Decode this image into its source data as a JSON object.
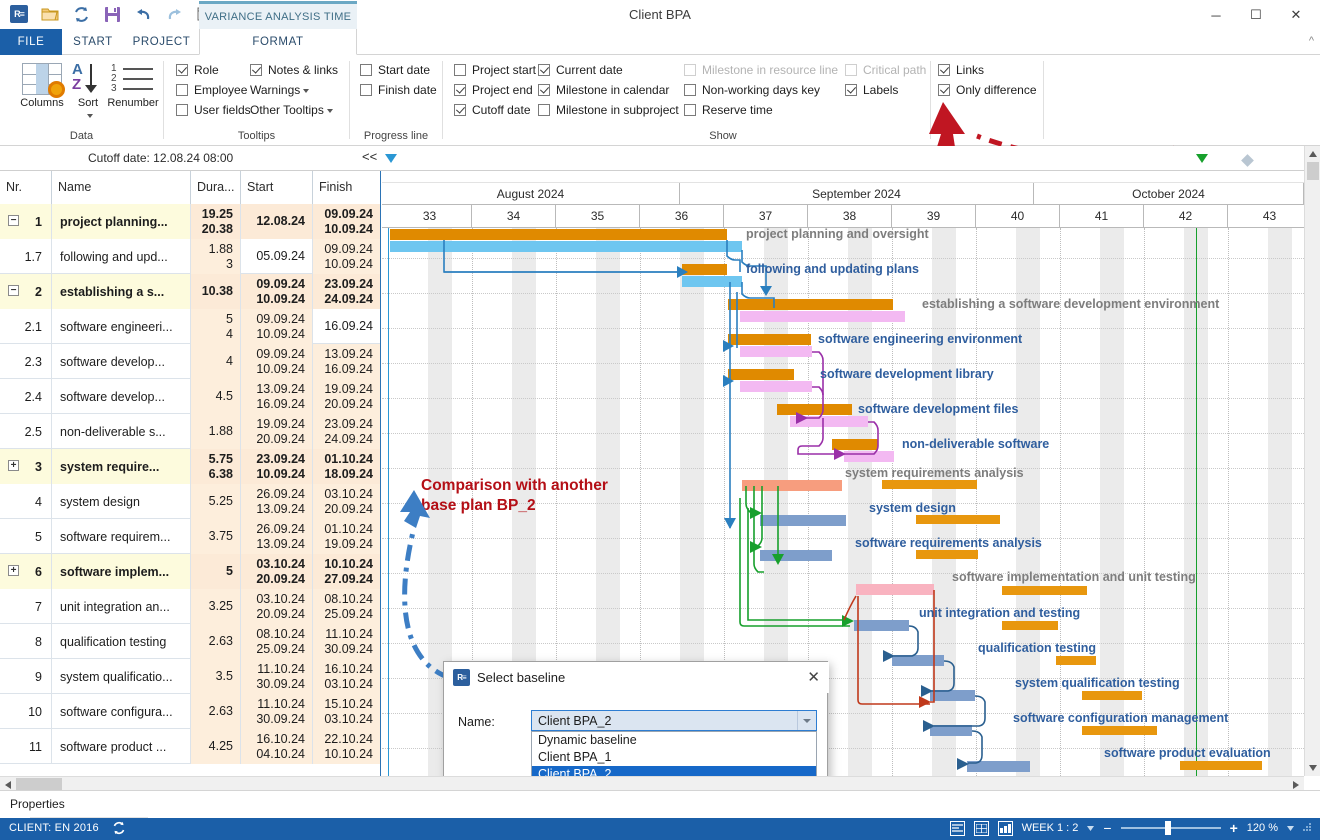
{
  "window": {
    "title": "Client BPA",
    "minimize": "─",
    "maximize": "☐",
    "close": "✕"
  },
  "quick_access": [
    {
      "name": "app-logo-icon",
      "glyph": "R≡"
    },
    {
      "name": "open-icon",
      "glyph": "🗁"
    },
    {
      "name": "refresh-icon",
      "glyph": "↻"
    },
    {
      "name": "save-icon",
      "glyph": "💾"
    },
    {
      "name": "undo-icon",
      "glyph": "↶"
    },
    {
      "name": "redo-icon",
      "glyph": "↷"
    },
    {
      "name": "window-icon",
      "glyph": "▭"
    },
    {
      "name": "customize-qat-icon",
      "glyph": "▾"
    }
  ],
  "ribbon": {
    "contextual_tab": "VARIANCE ANALYSIS TIME",
    "tabs": [
      {
        "label": "FILE",
        "active": false
      },
      {
        "label": "START",
        "active": false
      },
      {
        "label": "PROJECT",
        "active": false
      },
      {
        "label": "FORMAT",
        "active": true
      }
    ],
    "groups": [
      {
        "label": "Data",
        "buttons": [
          {
            "label": "Columns",
            "icon": "columns-icon"
          },
          {
            "label": "Sort",
            "icon": "sort-icon",
            "has_dropdown": true
          },
          {
            "label": "Renumber",
            "icon": "renumber-icon"
          }
        ]
      },
      {
        "label": "Tooltips",
        "checkboxes": [
          {
            "label": "Role",
            "checked": true
          },
          {
            "label": "Employee",
            "checked": false
          },
          {
            "label": "User fields",
            "checked": false
          },
          {
            "label": "Notes & links",
            "checked": true
          }
        ],
        "menus": [
          {
            "label": "Warnings"
          },
          {
            "label": "Other Tooltips"
          }
        ]
      },
      {
        "label": "Progress line",
        "checkboxes": [
          {
            "label": "Start date",
            "checked": false
          },
          {
            "label": "Finish date",
            "checked": false
          }
        ]
      },
      {
        "label": "Show",
        "checkboxes": [
          {
            "label": "Project start",
            "checked": false,
            "disabled": false
          },
          {
            "label": "Project end",
            "checked": true,
            "disabled": false
          },
          {
            "label": "Cutoff date",
            "checked": true,
            "disabled": false
          },
          {
            "label": "Current date",
            "checked": true,
            "disabled": false
          },
          {
            "label": "Milestone in calendar",
            "checked": true,
            "disabled": false
          },
          {
            "label": "Milestone in subproject",
            "checked": false,
            "disabled": false
          },
          {
            "label": "Milestone in resource line",
            "checked": false,
            "disabled": true
          },
          {
            "label": "Non-working days key",
            "checked": false,
            "disabled": false
          },
          {
            "label": "Reserve time",
            "checked": false,
            "disabled": false
          },
          {
            "label": "Critical path",
            "checked": false,
            "disabled": true
          },
          {
            "label": "Labels",
            "checked": true,
            "disabled": false
          },
          {
            "label": "Links",
            "checked": true,
            "disabled": false
          },
          {
            "label": "Only difference",
            "checked": true,
            "disabled": false
          }
        ]
      }
    ]
  },
  "cutoff": {
    "text": "Cutoff date: 12.08.24 08:00",
    "collapse": "<<"
  },
  "table": {
    "columns": [
      "Nr.",
      "Name",
      "Dura...",
      "Start",
      "Finish"
    ],
    "rows": [
      {
        "nr": "1",
        "name": "project planning...",
        "dur1": "19.25",
        "dur2": "20.38",
        "start1": "12.08.24",
        "start2": "",
        "fin1": "09.09.24",
        "fin2": "10.09.24",
        "summary": true,
        "expander": "−"
      },
      {
        "nr": "1.7",
        "name": "following and upd...",
        "dur1": "1.88",
        "dur2": "3",
        "start1": "05.09.24",
        "start2": "",
        "fin1": "09.09.24",
        "fin2": "10.09.24",
        "summary": false,
        "expander": ""
      },
      {
        "nr": "2",
        "name": "establishing a s...",
        "dur1": "10.38",
        "dur2": "",
        "start1": "09.09.24",
        "start2": "10.09.24",
        "fin1": "23.09.24",
        "fin2": "24.09.24",
        "summary": true,
        "expander": "−"
      },
      {
        "nr": "2.1",
        "name": "software engineeri...",
        "dur1": "5",
        "dur2": "4",
        "start1": "09.09.24",
        "start2": "10.09.24",
        "fin1": "16.09.24",
        "fin2": "",
        "summary": false,
        "expander": ""
      },
      {
        "nr": "2.3",
        "name": "software develop...",
        "dur1": "4",
        "dur2": "",
        "start1": "09.09.24",
        "start2": "10.09.24",
        "fin1": "13.09.24",
        "fin2": "16.09.24",
        "summary": false,
        "expander": ""
      },
      {
        "nr": "2.4",
        "name": "software develop...",
        "dur1": "4.5",
        "dur2": "",
        "start1": "13.09.24",
        "start2": "16.09.24",
        "fin1": "19.09.24",
        "fin2": "20.09.24",
        "summary": false,
        "expander": ""
      },
      {
        "nr": "2.5",
        "name": "non-deliverable s...",
        "dur1": "1.88",
        "dur2": "",
        "start1": "19.09.24",
        "start2": "20.09.24",
        "fin1": "23.09.24",
        "fin2": "24.09.24",
        "summary": false,
        "expander": ""
      },
      {
        "nr": "3",
        "name": "system require...",
        "dur1": "5.75",
        "dur2": "6.38",
        "start1": "23.09.24",
        "start2": "10.09.24",
        "fin1": "01.10.24",
        "fin2": "18.09.24",
        "summary": true,
        "expander": "+"
      },
      {
        "nr": "4",
        "name": "system design",
        "dur1": "5.25",
        "dur2": "",
        "start1": "26.09.24",
        "start2": "13.09.24",
        "fin1": "03.10.24",
        "fin2": "20.09.24",
        "summary": false,
        "expander": ""
      },
      {
        "nr": "5",
        "name": "software requirem...",
        "dur1": "3.75",
        "dur2": "",
        "start1": "26.09.24",
        "start2": "13.09.24",
        "fin1": "01.10.24",
        "fin2": "19.09.24",
        "summary": false,
        "expander": ""
      },
      {
        "nr": "6",
        "name": "software implem...",
        "dur1": "5",
        "dur2": "",
        "start1": "03.10.24",
        "start2": "20.09.24",
        "fin1": "10.10.24",
        "fin2": "27.09.24",
        "summary": true,
        "expander": "+"
      },
      {
        "nr": "7",
        "name": "unit integration an...",
        "dur1": "3.25",
        "dur2": "",
        "start1": "03.10.24",
        "start2": "20.09.24",
        "fin1": "08.10.24",
        "fin2": "25.09.24",
        "summary": false,
        "expander": ""
      },
      {
        "nr": "8",
        "name": "qualification testing",
        "dur1": "2.63",
        "dur2": "",
        "start1": "08.10.24",
        "start2": "25.09.24",
        "fin1": "11.10.24",
        "fin2": "30.09.24",
        "summary": false,
        "expander": ""
      },
      {
        "nr": "9",
        "name": "system qualificatio...",
        "dur1": "3.5",
        "dur2": "",
        "start1": "11.10.24",
        "start2": "30.09.24",
        "fin1": "16.10.24",
        "fin2": "03.10.24",
        "summary": false,
        "expander": ""
      },
      {
        "nr": "10",
        "name": "software configura...",
        "dur1": "2.63",
        "dur2": "",
        "start1": "11.10.24",
        "start2": "30.09.24",
        "fin1": "15.10.24",
        "fin2": "03.10.24",
        "summary": false,
        "expander": ""
      },
      {
        "nr": "11",
        "name": "software product ...",
        "dur1": "4.25",
        "dur2": "",
        "start1": "16.10.24",
        "start2": "04.10.24",
        "fin1": "22.10.24",
        "fin2": "10.10.24",
        "summary": false,
        "expander": ""
      }
    ]
  },
  "timeline": {
    "months": [
      {
        "label": "August 2024",
        "start": 0,
        "span": 3.55
      },
      {
        "label": "September 2024",
        "start": 3.55,
        "span": 4.2
      },
      {
        "label": "October 2024",
        "start": 7.75,
        "span": 3.25
      }
    ],
    "weeks": [
      "33",
      "34",
      "35",
      "36",
      "37",
      "38",
      "39",
      "40",
      "41",
      "42",
      "43"
    ]
  },
  "gantt": {
    "tasks": [
      {
        "label": "project planning and oversight",
        "label_color": "gray"
      },
      {
        "label": "following and updating plans",
        "label_color": "blue"
      },
      {
        "label": "establishing a software development environment",
        "label_color": "gray"
      },
      {
        "label": "software engineering environment",
        "label_color": "blue"
      },
      {
        "label": "software development library",
        "label_color": "blue"
      },
      {
        "label": "software development files",
        "label_color": "blue"
      },
      {
        "label": "non-deliverable software",
        "label_color": "blue"
      },
      {
        "label": "system requirements analysis",
        "label_color": "gray"
      },
      {
        "label": "system design",
        "label_color": "blue"
      },
      {
        "label": "software requirements analysis",
        "label_color": "blue"
      },
      {
        "label": "software implementation and unit testing",
        "label_color": "gray"
      },
      {
        "label": "unit integration and testing",
        "label_color": "blue"
      },
      {
        "label": "qualification testing",
        "label_color": "blue"
      },
      {
        "label": "system qualification testing",
        "label_color": "blue"
      },
      {
        "label": "software configuration management",
        "label_color": "blue"
      },
      {
        "label": "software product evaluation",
        "label_color": "blue"
      }
    ]
  },
  "annotations": {
    "comparison": "Comparison with another\nbase plan BP_2",
    "comparison_line1": "Comparison with another",
    "comparison_line2": "base plan BP_2"
  },
  "dialog": {
    "title": "Select baseline",
    "close": "✕",
    "name_label": "Name:",
    "selected_value": "Client BPA_2",
    "options": [
      "Dynamic baseline",
      "Client BPA_1",
      "Client BPA_2"
    ],
    "selected_index": 2
  },
  "properties_bar": {
    "label": "Properties"
  },
  "status_bar": {
    "client": "CLIENT: EN 2016",
    "sync_icon": "↻",
    "view_icons": [
      "list-view-icon",
      "grid-view-icon",
      "chart-view-icon"
    ],
    "scale": "WEEK 1 : 2",
    "zoom_out": "−",
    "zoom_in": "+",
    "zoom_level": "120 %"
  },
  "colors": {
    "accent": "#1b5fa8",
    "bar_current": "#e08a00",
    "bar_baseline_blue": "#6ec6f0",
    "bar_baseline_pink": "#f3b9f2",
    "bar_baseline_salmon": "#f79d7e",
    "bar_baseline_rose": "#f9b3c0",
    "bar_steel": "#7e9ecb",
    "annotation_red": "#b40f16",
    "label_blue": "#2f5e9e",
    "label_gray": "#7d7d7d"
  }
}
